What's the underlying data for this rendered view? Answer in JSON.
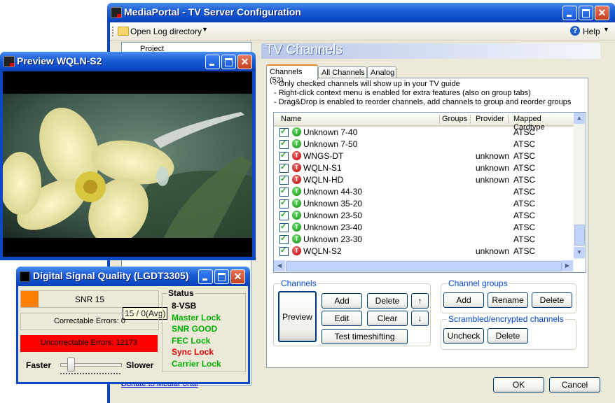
{
  "main_window": {
    "title": "MediaPortal - TV Server Configuration",
    "toolbar": {
      "open_log": "Open Log directory",
      "help": "Help"
    },
    "tree_item": "Project",
    "donate_link": "Donate to MediaPortal",
    "section_title": "TV Channels",
    "tabs": [
      {
        "label": "Channels (52)",
        "active": true
      },
      {
        "label": "All Channels",
        "active": false
      },
      {
        "label": "Analog",
        "active": false
      }
    ],
    "info_lines": [
      "- Only checked channels will show up in your TV guide",
      "- Right-click context menu is enabled for extra features (also on group tabs)",
      "- Drag&Drop is enabled to reorder channels, add channels to group and reorder groups"
    ],
    "table": {
      "columns": [
        "Name",
        "Groups",
        "Provider",
        "Mapped Cardtype"
      ],
      "rows": [
        {
          "name": "Unknown 7-40",
          "provider": "",
          "cardtype": "ATSC",
          "icon": "green"
        },
        {
          "name": "Unknown 7-50",
          "provider": "",
          "cardtype": "ATSC",
          "icon": "green"
        },
        {
          "name": "WNGS-DT",
          "provider": "unknown",
          "cardtype": "ATSC",
          "icon": "red"
        },
        {
          "name": "WQLN-S1",
          "provider": "unknown",
          "cardtype": "ATSC",
          "icon": "red"
        },
        {
          "name": "WQLN-HD",
          "provider": "unknown",
          "cardtype": "ATSC",
          "icon": "red"
        },
        {
          "name": "Unknown 44-30",
          "provider": "",
          "cardtype": "ATSC",
          "icon": "green"
        },
        {
          "name": "Unknown 35-20",
          "provider": "",
          "cardtype": "ATSC",
          "icon": "green"
        },
        {
          "name": "Unknown 23-50",
          "provider": "",
          "cardtype": "ATSC",
          "icon": "green"
        },
        {
          "name": "Unknown 23-40",
          "provider": "",
          "cardtype": "ATSC",
          "icon": "green"
        },
        {
          "name": "Unknown 23-30",
          "provider": "",
          "cardtype": "ATSC",
          "icon": "green"
        },
        {
          "name": "WQLN-S2",
          "provider": "unknown",
          "cardtype": "ATSC",
          "icon": "red"
        }
      ]
    },
    "channels_group": {
      "label": "Channels",
      "preview": "Preview",
      "add": "Add",
      "delete": "Delete",
      "edit": "Edit",
      "clear": "Clear",
      "test_timeshifting": "Test timeshifting",
      "up": "↑",
      "down": "↓"
    },
    "channel_groups": {
      "label": "Channel groups",
      "add": "Add",
      "rename": "Rename",
      "delete": "Delete"
    },
    "scrambled": {
      "label": "Scrambled/encrypted channels",
      "uncheck": "Uncheck",
      "delete": "Delete"
    },
    "ok": "OK",
    "cancel": "Cancel"
  },
  "preview_window": {
    "title": "Preview WQLN-S2"
  },
  "signal_window": {
    "title": "Digital Signal Quality (LGDT3305)",
    "snr": "SNR 15",
    "snr_tooltip": "15 / 0(Avg)",
    "snr_level": 0.13,
    "correctable": "Correctable Errors:  0",
    "uncorrectable": "Uncorrectable Errors:  12173",
    "faster": "Faster",
    "slower": "Slower",
    "status_label": "Status",
    "status": [
      {
        "text": "8-VSB",
        "color": "#000000"
      },
      {
        "text": "Master Lock",
        "color": "#00b000"
      },
      {
        "text": "SNR GOOD",
        "color": "#00b000"
      },
      {
        "text": "FEC Lock",
        "color": "#00b000"
      },
      {
        "text": "Sync Lock",
        "color": "#e00000"
      },
      {
        "text": "Carrier Lock",
        "color": "#00b000"
      }
    ]
  }
}
